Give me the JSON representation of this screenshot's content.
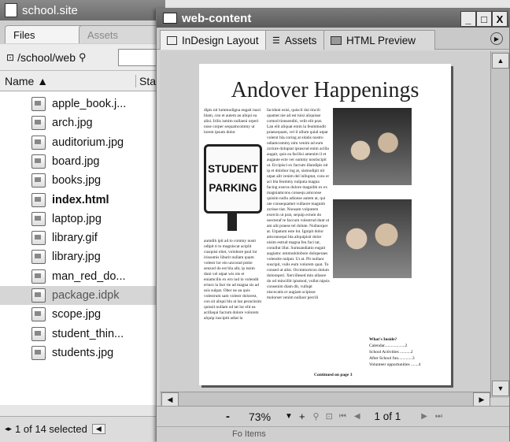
{
  "site_window": {
    "title": "school.site",
    "tabs": [
      {
        "label": "Files"
      },
      {
        "label": "Assets"
      }
    ],
    "path": "/school/web",
    "columns": {
      "name": "Name ▲",
      "status": "Stat"
    },
    "files": [
      {
        "name": "apple_book.j...",
        "status": ""
      },
      {
        "name": "arch.jpg",
        "status": ""
      },
      {
        "name": "auditorium.jpg",
        "status": ""
      },
      {
        "name": "board.jpg",
        "status": ""
      },
      {
        "name": "books.jpg",
        "status": ""
      },
      {
        "name": "index.html",
        "status": "✓",
        "bold": true
      },
      {
        "name": "laptop.jpg",
        "status": ""
      },
      {
        "name": "library.gif",
        "status": ""
      },
      {
        "name": "library.jpg",
        "status": ""
      },
      {
        "name": "man_red_do...",
        "status": ""
      },
      {
        "name": "package.idpk",
        "status": "✓",
        "selected": true
      },
      {
        "name": "scope.jpg",
        "status": ""
      },
      {
        "name": "student_thin...",
        "status": ""
      },
      {
        "name": "students.jpg",
        "status": ""
      }
    ],
    "status_text": "1 of 14 selected"
  },
  "web_window": {
    "title": "web-content",
    "buttons": {
      "minimize": "_",
      "maximize": "□",
      "close": "X"
    },
    "tabs": [
      {
        "label": "InDesign Layout",
        "icon": "layout-icon"
      },
      {
        "label": "Assets",
        "icon": "assets-icon"
      },
      {
        "label": "HTML Preview",
        "icon": "preview-icon"
      }
    ],
    "zoom_minus": "-",
    "zoom": "73%",
    "zoom_plus": "+",
    "page_info": "1 of 1",
    "footer_text": "Fo Items"
  },
  "document": {
    "title": "Andover Happenings",
    "sign_line1": "STUDENT",
    "sign_line2": "PARKING",
    "continued": "Continued on page 3",
    "sidebar": {
      "heading": "What's Inside?",
      "items": [
        "Calendar...................2",
        "School Activities ..........2",
        "After School fun.............3",
        "Volunteer opportunities .......4"
      ]
    }
  }
}
